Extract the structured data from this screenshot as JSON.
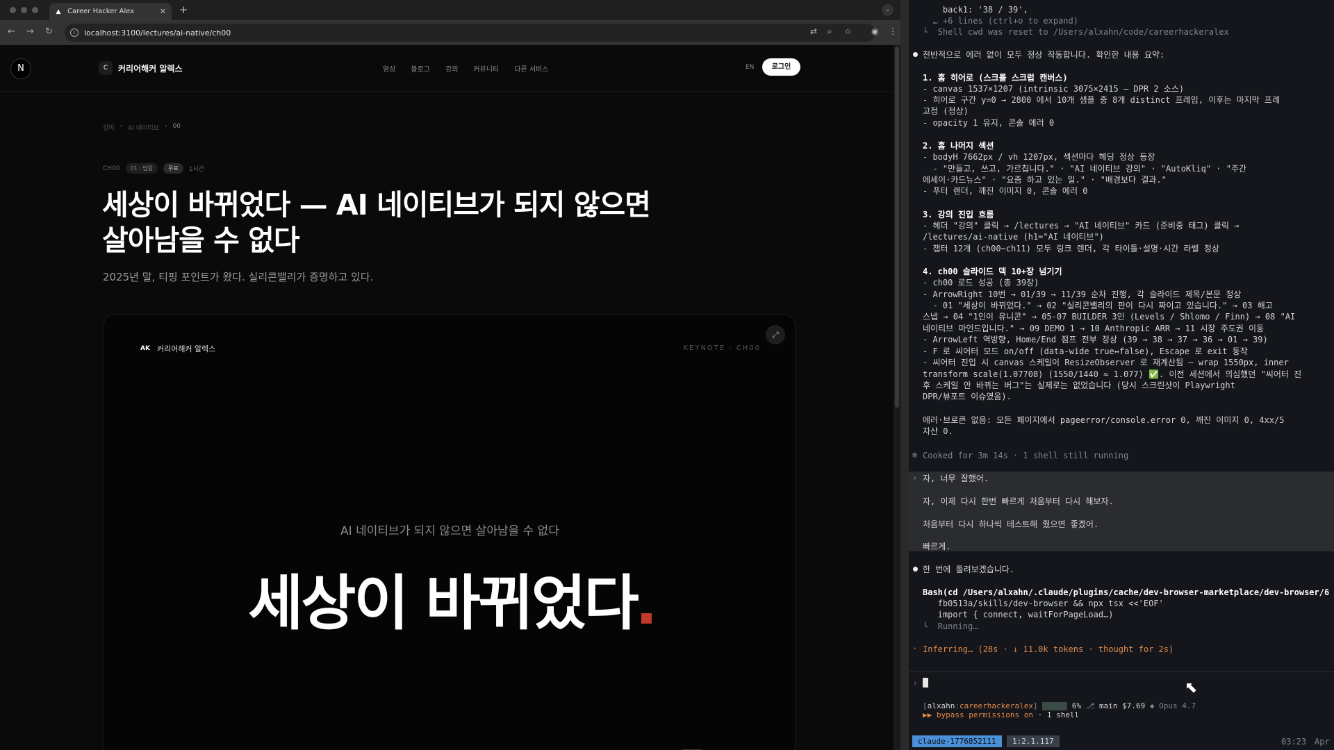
{
  "browser": {
    "tab_title": "Career Hacker Alex",
    "url": "localhost:3100/lectures/ai-native/ch00",
    "site": {
      "logo_letter": "N",
      "brand_mark": "C",
      "brand_name": "커리어해커 알렉스",
      "nav": [
        "영상",
        "블로그",
        "강의",
        "커뮤니티",
        "다른 서비스"
      ],
      "lang": "EN",
      "login": "로그인",
      "breadcrumb": [
        "강의",
        "AI 네이티브",
        "00"
      ],
      "chapter": "CH00",
      "pill_topic": "01 · 맘람",
      "pill_free": "무료",
      "duration": "1시간",
      "title": "세상이 바뀌었다 — AI 네이티브가 되지 않으면 살아남을 수 없다",
      "lede": "2025년 말, 티핑 포인트가 왔다. 실리콘밸리가 증명하고 있다.",
      "deck": {
        "brand_ak": "AK",
        "brand_name": "커리어해커 알렉스",
        "chip": "KEYNOTE · CH00",
        "subtitle": "AI 네이티브가 되지 않으면 살아남을 수 없다",
        "headline": "세상이 바뀌었다"
      }
    }
  },
  "terminal": {
    "lines": [
      {
        "text": "    back1: '38 / 39',",
        "cls": ""
      },
      {
        "text": "  … +6 lines (ctrl+o to expand)",
        "cls": "dim"
      },
      {
        "text": "└  Shell cwd was reset to /Users/alxahn/code/careerhackeralex",
        "cls": "dim"
      },
      {
        "text": "전반적으로 에러 없이 모두 정상 작동합니다. 확인한 내용 요약:",
        "cls": ""
      },
      {
        "text": "1. 홈 히어로 (스크롤 스크럽 캔버스)",
        "cls": "b"
      },
      {
        "text": "- canvas 1537×1207 (intrinsic 3075×2415 — DPR 2 소스)",
        "cls": ""
      },
      {
        "text": "- 히어로 구간 y=0 → 2800 에서 10개 샘플 중 8개 distinct 프레임, 이후는 마지막 프레",
        "cls": ""
      },
      {
        "text": "고정 (정상)",
        "cls": ""
      },
      {
        "text": "- opacity 1 유지, 콘솔 에러 0",
        "cls": ""
      },
      {
        "text": "2. 홈 나머지 섹션",
        "cls": "b"
      },
      {
        "text": "- bodyH 7662px / vh 1207px, 섹션마다 헤딩 정상 등장",
        "cls": ""
      },
      {
        "text": "  - \"만들고, 쓰고, 가르칩니다.\" · \"AI 네이티브 강의\" · \"AutoKliq\" · \"주간",
        "cls": ""
      },
      {
        "text": "에세이·카드뉴스\" · \"요즘 하고 있는 일.\" · \"배경보다 결과.\"",
        "cls": ""
      },
      {
        "text": "- 푸터 렌더, 깨진 이미지 0, 콘솔 에러 0",
        "cls": ""
      },
      {
        "text": "3. 강의 진입 흐름",
        "cls": "b"
      },
      {
        "text": "- 헤더 \"강의\" 클릭 → /lectures → \"AI 네이티브\" 카드 (준비중 태그) 클릭 →",
        "cls": ""
      },
      {
        "text": "/lectures/ai-native (h1=\"AI 네이티브\")",
        "cls": ""
      },
      {
        "text": "- 챕터 12개 (ch00~ch11) 모두 링크 렌더, 각 타이틀·설명·시간 라벨 정상",
        "cls": ""
      },
      {
        "text": "4. ch00 슬라이드 덱 10+장 넘기기",
        "cls": "b"
      },
      {
        "text": "- ch00 로드 성공 (총 39장)",
        "cls": ""
      },
      {
        "text": "- ArrowRight 10번 → 01/39 → 11/39 순차 진행, 각 슬라이드 제목/본문 정상",
        "cls": ""
      },
      {
        "text": "  - 01 \"세상이 바뀌었다.\" → 02 \"실리콘밸리의 판이 다시 짜이고 있습니다.\" → 03 해고",
        "cls": ""
      },
      {
        "text": "스냅 → 04 \"1인이 유니콘\" → 05-07 BUILDER 3인 (Levels / Shlomo / Finn) → 08 \"AI",
        "cls": ""
      },
      {
        "text": "네이티브 마인드입니다.\" → 09 DEMO 1 → 10 Anthropic ARR → 11 시장 주도권 이동",
        "cls": ""
      },
      {
        "text": "- ArrowLeft 역방향, Home/End 점프 전부 정상 (39 → 38 → 37 → 36 → 01 → 39)",
        "cls": ""
      },
      {
        "text": "- F 로 씨어터 모드 on/off (data-wide true↔false), Escape 로 exit 동작",
        "cls": ""
      },
      {
        "text": "- 씨어터 진입 시 canvas 스케일이 ResizeObserver 로 재계산됨 — wrap 1550px, inner",
        "cls": ""
      },
      {
        "text": "transform scale(1.07708) (1550/1440 ≈ 1.077) ✅. 이전 세션에서 의심했던 \"씨어터 진",
        "cls": ""
      },
      {
        "text": "후 스케일 안 바뀌는 버그\"는 실제로는 없었습니다 (당시 스크린샷이 Playwright",
        "cls": ""
      },
      {
        "text": "DPR/뷰포트 이슈였음).",
        "cls": ""
      },
      {
        "text": "에러·브로큰 없음: 모든 페이지에서 pageerror/console.error 0, 깨진 이미지 0, 4xx/5",
        "cls": ""
      },
      {
        "text": "자산 0.",
        "cls": ""
      },
      {
        "text": "Cooked for 3m 14s · 1 shell still running",
        "cls": "dim"
      },
      {
        "text": "자, 너무 잘했어.",
        "cls": ""
      },
      {
        "text": "자, 이제 다시 한번 빠르게 처음부터 다시 해보자.",
        "cls": ""
      },
      {
        "text": "처음부터 다시 하나씩 테스트해 줬으면 좋겠어.",
        "cls": ""
      },
      {
        "text": "빠르게.",
        "cls": ""
      },
      {
        "text": "한 번에 돌려보겠습니다.",
        "cls": ""
      },
      {
        "text": "Bash(cd /Users/alxahn/.claude/plugins/cache/dev-browser-marketplace/dev-browser/6",
        "cls": "b"
      },
      {
        "text": "   fb0513a/skills/dev-browser && npx tsx <<'EOF'",
        "cls": ""
      },
      {
        "text": "   import { connect, waitForPageLoad…)",
        "cls": ""
      },
      {
        "text": "└  Running…",
        "cls": "dim"
      },
      {
        "text": "Inferring… (28s · ↓ 11.0k tokens · thought for 2s)",
        "cls": "orange"
      }
    ],
    "status_user": "alxahn",
    "status_repo": "careerhackeralex",
    "status_pct": "6%",
    "status_branch": "main",
    "status_cost": "$7.69",
    "status_model": "Opus 4.7",
    "status_mode": "▶▶ bypass permissions on",
    "status_shells": "· 1 shell",
    "session_tag": "claude-1776852111",
    "pane_tag": "1:2.1.117",
    "clock": "03:23",
    "date_frag": "Apr"
  }
}
